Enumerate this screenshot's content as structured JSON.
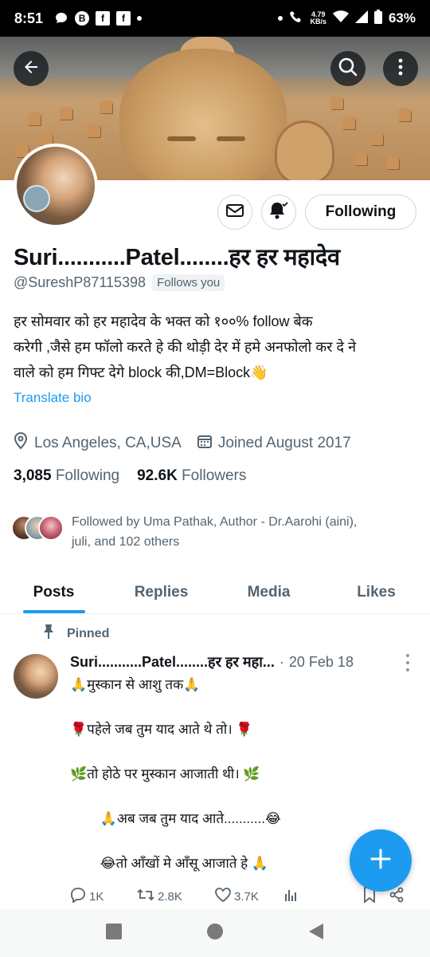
{
  "status_bar": {
    "time": "8:51",
    "notif_letter_1": "B",
    "notif_letter_2": "f",
    "notif_letter_3": "f",
    "speed_top": "4.79",
    "speed_bottom": "KB/s",
    "battery": "63%"
  },
  "profile": {
    "name": "Suri...........Patel........हर हर महादेव",
    "handle": "@SureshP87115398",
    "follows_you": "Follows you",
    "bio_lines": [
      "हर सोमवार को हर महादेव के भक्त को १००% follow बेक",
      "करेगी ,जैसे हम फॉलो करते हे की थोड़ी देर में हमे अनफोलो कर दे ने",
      "वाले को हम गिफ्ट देगे block की,DM=Block👋"
    ],
    "translate_bio": "Translate bio",
    "location": "Los Angeles, CA,USA",
    "joined": "Joined August 2017",
    "following_count": "3,085",
    "following_label": "Following",
    "followers_count": "92.6K",
    "followers_label": "Followers",
    "followed_by_line1": "Followed by Uma Pathak, Author - Dr.Aarohi (aini),",
    "followed_by_line2": "juli, and 102 others",
    "following_button": "Following"
  },
  "tabs": [
    "Posts",
    "Replies",
    "Media",
    "Likes"
  ],
  "post": {
    "pinned_label": "Pinned",
    "author": "Suri...........Patel........हर हर महा...",
    "separator": "·",
    "date": "20 Feb 18",
    "lines": [
      "🙏मुस्कान से आशु तक🙏",
      "",
      "🌹पहेले जब तुम याद आते थे तो। 🌹",
      "",
      "🌿तो होठे पर मुस्कान आजाती थी। 🌿",
      "",
      "        🙏अब जब तुम याद आते...........😂",
      "",
      "        😂तो आँखों मे आँसू आजाते हे 🙏"
    ],
    "replies": "1K",
    "reposts": "2.8K",
    "likes": "3.7K"
  },
  "colors": {
    "accent": "#1d9bf0",
    "text_primary": "#0f1419",
    "text_secondary": "#536471"
  },
  "icons": {
    "back": "arrow-left-icon",
    "search": "search-icon",
    "more": "more-vertical-icon",
    "message": "envelope-icon",
    "notifications": "bell-check-icon",
    "location": "location-pin-icon",
    "calendar": "calendar-icon",
    "pin": "pin-icon",
    "reply": "reply-icon",
    "repost": "repost-icon",
    "like": "heart-icon",
    "views": "bar-chart-icon",
    "bookmark": "bookmark-icon",
    "share": "share-icon",
    "compose": "plus-icon"
  }
}
